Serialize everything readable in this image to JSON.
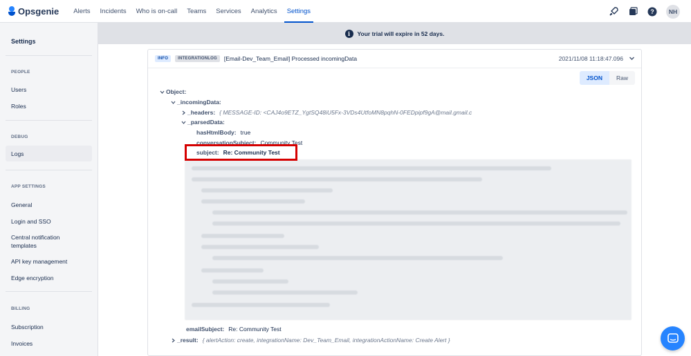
{
  "app": {
    "logo_text": "Opsgenie"
  },
  "nav": {
    "items": [
      {
        "label": "Alerts"
      },
      {
        "label": "Incidents"
      },
      {
        "label": "Who is on-call"
      },
      {
        "label": "Teams"
      },
      {
        "label": "Services"
      },
      {
        "label": "Analytics"
      },
      {
        "label": "Settings",
        "active": true
      }
    ],
    "avatar_initials": "NH"
  },
  "sidebar": {
    "title": "Settings",
    "sections": [
      {
        "heading": "PEOPLE",
        "items": [
          "Users",
          "Roles"
        ]
      },
      {
        "heading": "DEBUG",
        "items": [
          "Logs"
        ]
      },
      {
        "heading": "APP SETTINGS",
        "items": [
          "General",
          "Login and SSO",
          "Central notification templates",
          "API key management",
          "Edge encryption"
        ]
      },
      {
        "heading": "BILLING",
        "items": [
          "Subscription",
          "Invoices"
        ]
      }
    ],
    "active_item": "Logs"
  },
  "banner": {
    "text": "Your trial will expire in 52 days."
  },
  "log": {
    "level_badge": "INFO",
    "type_badge": "INTEGRATIONLOG",
    "message": "[Email-Dev_Team_Email] Processed incomingData",
    "timestamp": "2021/11/08 11:18:47.096",
    "view_toggle": {
      "json_label": "JSON",
      "raw_label": "Raw",
      "active": "JSON"
    },
    "tree": {
      "root_key": "Object:",
      "incoming_key": "_incomingData:",
      "headers_key": "_headers:",
      "headers_preview": "{ MESSAGE-ID: <CAJ4o9ETZ_YgtSQ48iU5Fx-3VDs4UtfoMN8pqhN-0FEDpipf9gA@mail.gmail.c",
      "parsed_key": "_parsedData:",
      "has_html_key": "hasHtmlBody:",
      "has_html_val": "true",
      "conv_subject_key": "conversationSubject:",
      "conv_subject_val": "Community Test",
      "subject_key": "subject:",
      "subject_val": "Re: Community Test",
      "email_subject_key": "emailSubject:",
      "email_subject_val": "Re: Community Test",
      "result_key": "_result:",
      "result_preview": "{ alertAction: create, integrationName: Dev_Team_Email, integrationActionName: Create Alert }"
    }
  },
  "colors": {
    "brand": "#0052cc",
    "highlight": "#d50000",
    "chat": "#2684ff"
  }
}
